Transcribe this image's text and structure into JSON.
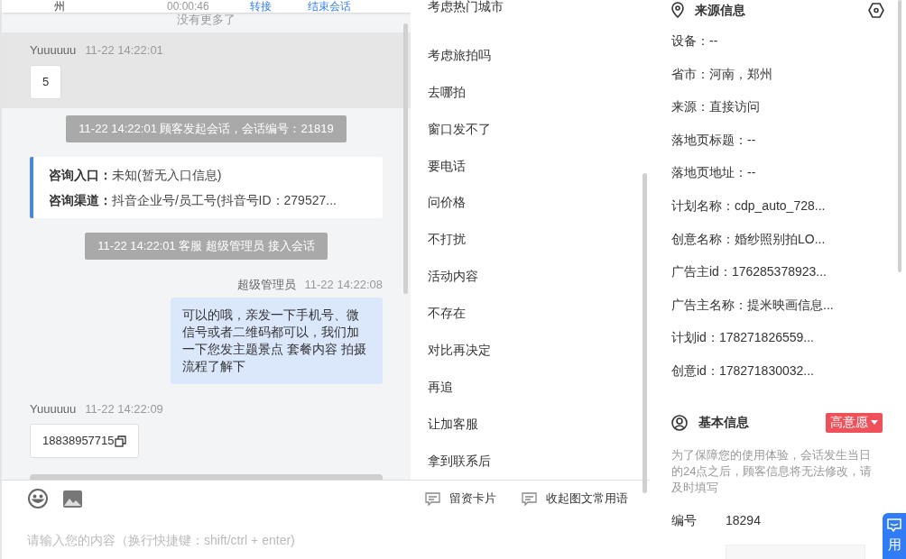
{
  "session_row": {
    "city": "州",
    "duration": "00:00:46",
    "transfer": "转接",
    "end": "结束会话"
  },
  "no_more": "没有更多了",
  "messages": [
    {
      "kind": "customer",
      "sender": "Yuuuuuu",
      "time": "11-22 14:22:01",
      "text": "5",
      "highlighted": true,
      "copyable": false
    },
    {
      "kind": "notice",
      "text": "11-22 14:22:01 顾客发起会话，会话编号：21819"
    },
    {
      "kind": "info",
      "rows": [
        {
          "label": "咨询入口：",
          "value": "未知(暂无入口信息)"
        },
        {
          "label": "咨询渠道：",
          "value": "抖音企业号/员工号(抖音号ID：279527..."
        }
      ]
    },
    {
      "kind": "notice",
      "text": "11-22 14:22:01 客服 超级管理员 接入会话"
    },
    {
      "kind": "agent",
      "sender": "超级管理员",
      "time": "11-22 14:22:08",
      "text": "可以的哦，亲发一下手机号、微信号或者二维码都可以，我们加一下您发主题景点 套餐内容 拍摄流程了解下"
    },
    {
      "kind": "customer",
      "sender": "Yuuuuuu",
      "time": "11-22 14:22:09",
      "text": "18838957715",
      "highlighted": false,
      "copyable": true
    }
  ],
  "input": {
    "placeholder": "请输入您的内容（换行快捷键：shift/ctrl + enter)"
  },
  "quick_replies": [
    "考虑热门城市",
    "考虑旅拍吗",
    "去哪拍",
    "窗口发不了",
    "要电话",
    "问价格",
    "不打扰",
    "活动内容",
    "不存在",
    "对比再决定",
    "再追",
    "让加客服",
    "拿到联系后"
  ],
  "toolbar_actions": [
    "留资卡片",
    "收起图文常用语"
  ],
  "source_info": {
    "title": "来源信息",
    "fields": [
      "设备：--",
      "省市：河南，郑州",
      "来源：直接访问",
      "落地页标题：--",
      "落地页地址：--",
      "计划名称：cdp_auto_728...",
      "创意名称：婚纱照别拍LO...",
      "广告主id：176285378923...",
      "广告主名称：提米映画信息...",
      "计划id：178271826559...",
      "创意id：178271830032..."
    ]
  },
  "basic_info": {
    "title": "基本信息",
    "intent": "高意愿",
    "notice": "为了保障您的使用体验，会话发生当日的24点之后，顾客信息将无法修改，请及时填写",
    "id_label": "编号",
    "id_value": "18294"
  },
  "float_button": {
    "label": "用"
  }
}
